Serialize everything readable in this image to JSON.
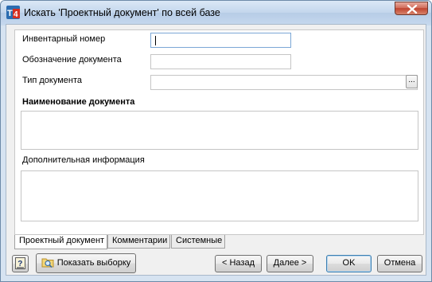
{
  "window": {
    "title": "Искать 'Проектный документ' по всей базе",
    "app_icon_text": "T4",
    "colors": {
      "accent": "#3c7fb1",
      "close": "#c0442f",
      "app_icon_blue": "#2b6cb0",
      "app_icon_red": "#d62d20"
    }
  },
  "form": {
    "inventory_label": "Инвентарный номер",
    "inventory_value": "",
    "designation_label": "Обозначение документа",
    "designation_value": "",
    "doc_type_label": "Тип документа",
    "doc_type_value": "",
    "doc_type_button": "...",
    "name_label": "Наименование документа",
    "name_value": "",
    "extra_label": "Дополнительная информация",
    "extra_value": ""
  },
  "tabs": [
    {
      "label": "Проектный документ",
      "active": true
    },
    {
      "label": "Комментарии",
      "active": false
    },
    {
      "label": "Системные",
      "active": false
    }
  ],
  "footer": {
    "help_icon": "help-question-icon",
    "show_selection_label": "Показать выборку",
    "show_selection_icon": "folder-search-icon",
    "back_label": "< Назад",
    "next_label": "Далее >",
    "ok_label": "OK",
    "cancel_label": "Отмена"
  }
}
